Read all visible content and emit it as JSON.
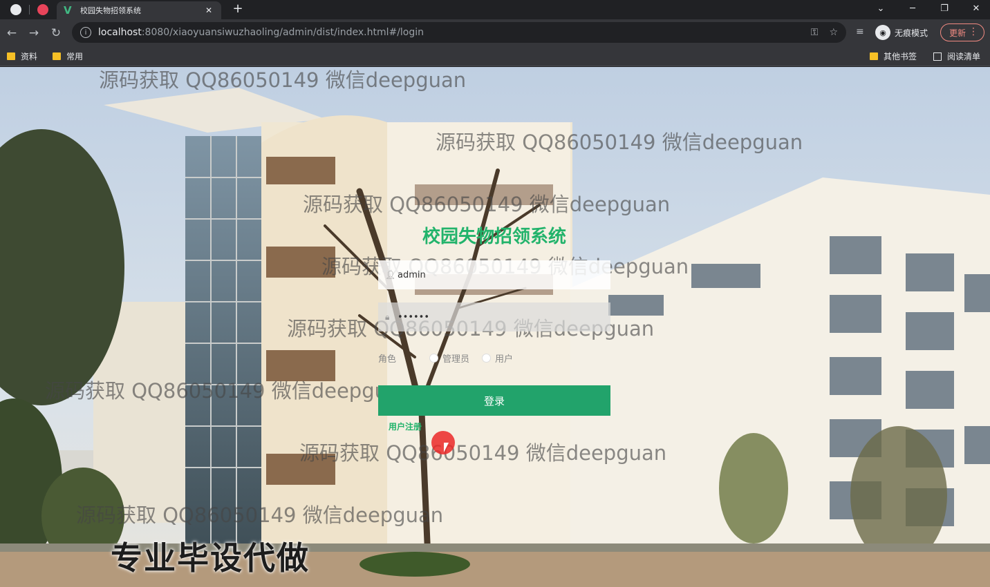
{
  "browser": {
    "active_tab_title": "校园失物招领系统",
    "tab_close": "✕",
    "new_tab": "+",
    "url_host": "localhost",
    "url_path": ":8080/xiaoyuansiwuzhaoling/admin/dist/index.html#/login",
    "incognito_label": "无痕模式",
    "update_label": "更新",
    "bookmarks": [
      "资料",
      "常用"
    ],
    "other_bookmarks": "其他书签",
    "reading_list": "阅读清单",
    "win_minimize": "─",
    "win_restore": "❐",
    "win_close": "✕",
    "tab_search": "⌄"
  },
  "login": {
    "title": "校园失物招领系统",
    "username_value": "admin",
    "password_value": "••••••",
    "role_label": "角色",
    "roles": [
      "管理员",
      "用户"
    ],
    "submit_label": "登录",
    "register_label": "用户注册"
  },
  "watermark": {
    "text": "源码获取 QQ86050149 微信deepguan",
    "ad_text": "专业毕设代做"
  },
  "colors": {
    "accent": "#22b36b",
    "button": "#22a36b",
    "chrome_dark": "#202124",
    "chrome_toolbar": "#35363a"
  }
}
